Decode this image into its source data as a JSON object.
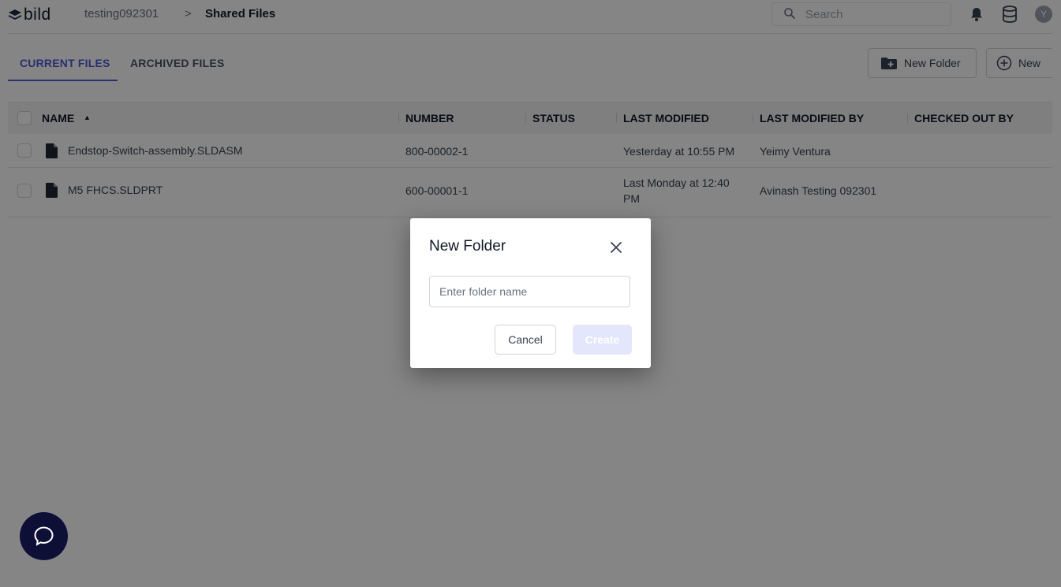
{
  "app": {
    "logo_text": "bild",
    "colors": {
      "accent": "#4f5bd5",
      "chat_button": "#0e0f37",
      "create_disabled": "#e4e7fb"
    }
  },
  "breadcrumb": {
    "project": "testing092301",
    "separator": ">",
    "current": "Shared Files"
  },
  "header": {
    "search_placeholder": "Search",
    "icons": [
      "search-icon",
      "bell-icon",
      "database-icon"
    ],
    "avatar_initial": "Y"
  },
  "tabs": [
    {
      "label": "CURRENT FILES",
      "active": true
    },
    {
      "label": "ARCHIVED FILES",
      "active": false
    }
  ],
  "toolbar": {
    "new_folder_label": "New Folder",
    "new_label": "New"
  },
  "table": {
    "columns": [
      "NAME",
      "NUMBER",
      "STATUS",
      "LAST MODIFIED",
      "LAST MODIFIED BY",
      "CHECKED OUT BY"
    ],
    "sort_indicator": "▲",
    "rows": [
      {
        "name": "Endstop-Switch-assembly.SLDASM",
        "number": "800-00002-1",
        "status": "",
        "last_modified": "Yesterday at 10:55 PM",
        "last_modified_by": "Yeimy Ventura",
        "checked_out_by": ""
      },
      {
        "name": "M5 FHCS.SLDPRT",
        "number": "600-00001-1",
        "status": "",
        "last_modified_line1": "Last Monday at 12:40",
        "last_modified_line2": "PM",
        "last_modified_by": "Avinash Testing 092301",
        "checked_out_by": ""
      }
    ]
  },
  "modal": {
    "title": "New Folder",
    "input_placeholder": "Enter folder name",
    "input_value": "",
    "cancel_label": "Cancel",
    "create_label": "Create",
    "create_disabled": true
  }
}
